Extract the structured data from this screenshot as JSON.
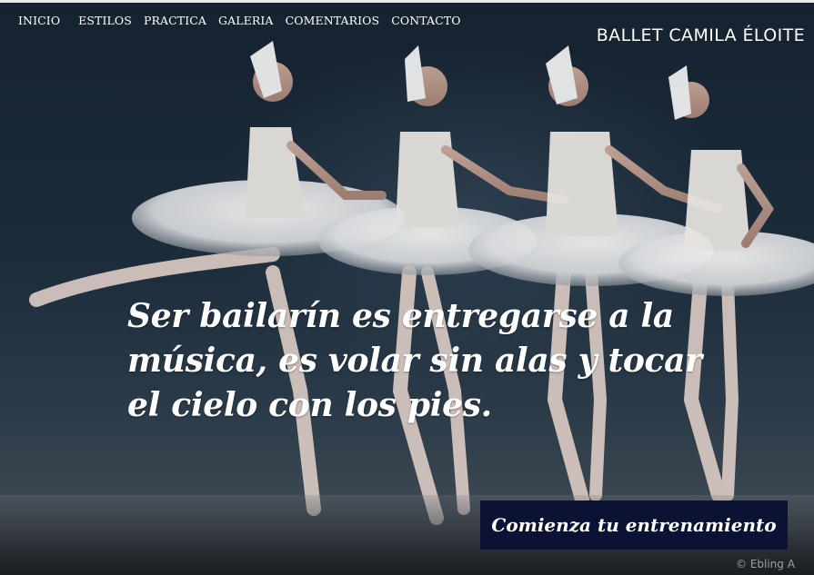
{
  "nav": {
    "items": [
      {
        "label": "INICIO"
      },
      {
        "label": "ESTILOS"
      },
      {
        "label": "PRACTICA"
      },
      {
        "label": "GALERIA"
      },
      {
        "label": "COMENTARIOS"
      },
      {
        "label": "CONTACTO"
      }
    ]
  },
  "brand": {
    "name": "BALLET CAMILA ÉLOITE"
  },
  "hero": {
    "quote_lines": [
      "Ser bailarín es entregarse a la",
      "música, es volar sin alas y tocar",
      "el cielo con los pies."
    ],
    "cta_label": "Comienza tu entrenamiento",
    "photo_credit": "© Ebling A"
  },
  "colors": {
    "background": "#152230",
    "cta_background": "#0b1233",
    "text": "#ffffff"
  }
}
